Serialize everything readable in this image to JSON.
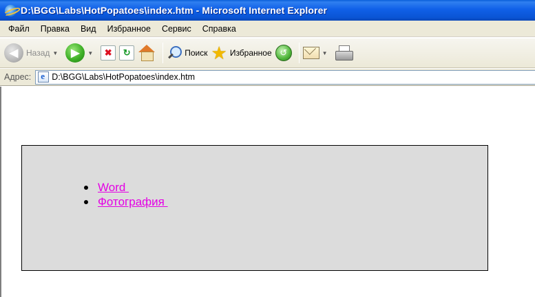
{
  "window": {
    "title": "D:\\BGG\\Labs\\HotPopatoes\\index.htm - Microsoft Internet Explorer"
  },
  "menu": {
    "items": [
      "Файл",
      "Правка",
      "Вид",
      "Избранное",
      "Сервис",
      "Справка"
    ]
  },
  "toolbar": {
    "back_label": "Назад",
    "search_label": "Поиск",
    "favorites_label": "Избранное"
  },
  "address": {
    "label": "Адрес:",
    "value": "D:\\BGG\\Labs\\HotPopatoes\\index.htm"
  },
  "page": {
    "links": [
      {
        "label": "Word "
      },
      {
        "label": "Фотография "
      }
    ]
  },
  "colors": {
    "link": "#e400e4",
    "panel_background": "#dcdcdc",
    "titlebar": "#0a54d4"
  }
}
